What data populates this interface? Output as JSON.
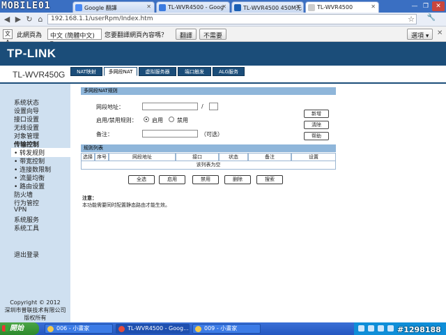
{
  "browser": {
    "watermark": "MOBILE01",
    "tabs": [
      {
        "title": "Google 翻譯",
        "active": false
      },
      {
        "title": "TL-WVR4500 - Goog",
        "active": false
      },
      {
        "title": "TL-WVR4500 450M无",
        "active": false
      },
      {
        "title": "TL-WVR4500",
        "active": true
      }
    ],
    "window_controls": [
      "—",
      "❐",
      "✕"
    ],
    "url": "192.168.1.1/userRpm/Index.htm"
  },
  "translate_bar": {
    "icon": "文A",
    "prompt1": "此網頁為",
    "language": "中文 (簡體中文)",
    "prompt2": "您要翻譯網頁內容嗎？",
    "translate_label": "翻譯",
    "no_label": "不需要",
    "options_label": "選項",
    "close": "✕"
  },
  "router": {
    "logo": "TP-LINK",
    "model": "TL-WVR450G",
    "subtabs": [
      "NAT映射",
      "多网段NAT",
      "虚拟服务器",
      "端口触发",
      "ALG服务"
    ],
    "active_subtab": 1,
    "sidebar": [
      {
        "label": "系统状态",
        "bold": false,
        "selected": false
      },
      {
        "label": "设置向导",
        "bold": false,
        "selected": false
      },
      {
        "label": "接口设置",
        "bold": false,
        "selected": false
      },
      {
        "label": "无线设置",
        "bold": false,
        "selected": false
      },
      {
        "label": "对象管理",
        "bold": false,
        "selected": false
      },
      {
        "label": "传输控制",
        "bold": true,
        "selected": false
      },
      {
        "label": "• 转发规则",
        "bold": false,
        "selected": true
      },
      {
        "label": "• 带宽控制",
        "bold": false,
        "selected": false
      },
      {
        "label": "• 连接数限制",
        "bold": false,
        "selected": false
      },
      {
        "label": "• 流量均衡",
        "bold": false,
        "selected": false
      },
      {
        "label": "• 路由设置",
        "bold": false,
        "selected": false
      },
      {
        "label": "防火墙",
        "bold": false,
        "selected": false
      },
      {
        "label": "行为管控",
        "bold": false,
        "selected": false
      },
      {
        "label": "VPN",
        "bold": false,
        "selected": false
      },
      {
        "label": "系统服务",
        "bold": false,
        "selected": false
      },
      {
        "label": "系统工具",
        "bold": false,
        "selected": false
      }
    ],
    "logout": "退出登录",
    "copyright": [
      "Copyright © 2012",
      "深圳市普联技术有限公司",
      "版权所有"
    ],
    "form": {
      "section_title": "多网段NAT规则",
      "segment_label": "网段地址：",
      "slash": "/",
      "enable_label": "启用/禁用规则：",
      "enable_option": "启用",
      "disable_option": "禁用",
      "remark_label": "备注：",
      "optional": "（可选）",
      "add_button": "新增",
      "clear_button": "清除",
      "help_button": "帮助"
    },
    "rule_list": {
      "title": "规则列表",
      "columns": [
        "选择",
        "序号",
        "网段地址",
        "接口",
        "状态",
        "备注",
        "设置"
      ],
      "empty": "该列表为空",
      "buttons": [
        "全选",
        "启用",
        "禁用",
        "删除",
        "搜索"
      ]
    },
    "note_title": "注意：",
    "note_text": "本功能需要同时配置静态路由才能生效。"
  },
  "taskbar": {
    "start": "開始",
    "items": [
      "006 - 小畫家",
      "TL-WVR4500 - Goog...",
      "009 - 小畫家"
    ],
    "stamp": "#1298188"
  }
}
